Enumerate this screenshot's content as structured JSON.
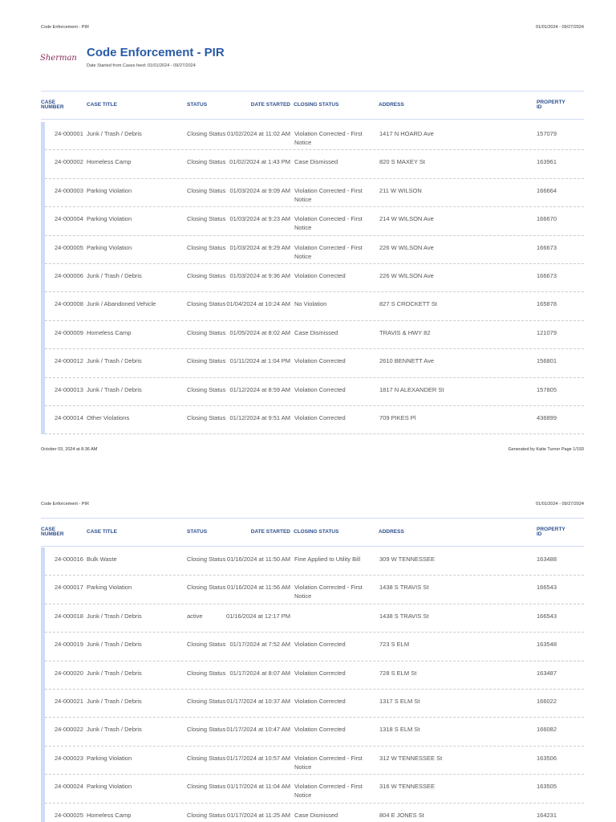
{
  "header": {
    "left": "Code Enforcement - PIR",
    "right": "01/01/2024 - 09/27/2024"
  },
  "report": {
    "logo_text": "Sherman",
    "title": "Code Enforcement - PIR",
    "subtitle": "Date Started from Cases feed: 01/01/2024 - 09/27/2024"
  },
  "columns": [
    "CASE NUMBER",
    "CASE TITLE",
    "STATUS",
    "DATE STARTED",
    "CLOSING STATUS",
    "ADDRESS",
    "PROPERTY ID"
  ],
  "footer": {
    "left": "October 03, 2024 at 8:36 AM",
    "right": "Generated by Katie Turner  Page 1/193"
  },
  "page1_rows": [
    [
      "24-000001",
      "Junk / Trash / Debris",
      "Closing Status",
      "01/02/2024 at 11:02 AM",
      "Violation Corrected - First Notice",
      "1417 N HOARD Ave",
      "157079"
    ],
    [
      "24-000002",
      "Homeless Camp",
      "Closing Status",
      "01/02/2024 at 1:43 PM",
      "Case Dismissed",
      "820 S MAXEY St",
      "163961"
    ],
    [
      "24-000003",
      "Parking Violation",
      "Closing Status",
      "01/03/2024 at 9:09 AM",
      "Violation Corrected - First Notice",
      "211 W WILSON",
      "166664"
    ],
    [
      "24-000004",
      "Parking Violation",
      "Closing Status",
      "01/03/2024 at 9:23 AM",
      "Violation Corrected - First Notice",
      "214 W WILSON Ave",
      "166670"
    ],
    [
      "24-000005",
      "Parking Violation",
      "Closing Status",
      "01/03/2024 at 9:29 AM",
      "Violation Corrected - First Notice",
      "226 W WILSON Ave",
      "166673"
    ],
    [
      "24-000006",
      "Junk / Trash / Debris",
      "Closing Status",
      "01/03/2024 at 9:36 AM",
      "Violation Corrected",
      "226 W WILSON Ave",
      "166673"
    ],
    [
      "24-000008",
      "Junk / Abandoned Vehicle",
      "Closing Status",
      "01/04/2024 at 10:24 AM",
      "No Violation",
      "827 S CROCKETT St",
      "165878"
    ],
    [
      "24-000009",
      "Homeless Camp",
      "Closing Status",
      "01/05/2024 at 8:02 AM",
      "Case Dismissed",
      "TRAVIS & HWY 82",
      "121079"
    ],
    [
      "24-000012",
      "Junk / Trash / Debris",
      "Closing Status",
      "01/11/2024 at 1:04 PM",
      "Violation Corrected",
      "2610 BENNETT Ave",
      "156801"
    ],
    [
      "24-000013",
      "Junk / Trash / Debris",
      "Closing Status",
      "01/12/2024 at 8:59 AM",
      "Violation Corrected",
      "1817 N ALEXANDER St",
      "157805"
    ],
    [
      "24-000014",
      "Other Violations",
      "Closing Status",
      "01/12/2024 at 9:51 AM",
      "Violation Corrected",
      "709 PIKES Pl",
      "436899"
    ]
  ],
  "page2_rows": [
    [
      "24-000016",
      "Bulk Waste",
      "Closing Status",
      "01/16/2024 at 11:50 AM",
      "Fine Applied to Utility Bill",
      "309 W TENNESSEE",
      "163488"
    ],
    [
      "24-000017",
      "Parking Violation",
      "Closing Status",
      "01/16/2024 at 11:56 AM",
      "Violation Corrected - First Notice",
      "1438 S TRAVIS St",
      "166543"
    ],
    [
      "24-000018",
      "Junk / Trash / Debris",
      "active",
      "01/16/2024 at 12:17 PM",
      "",
      "1438 S TRAVIS St",
      "166543"
    ],
    [
      "24-000019",
      "Junk / Trash / Debris",
      "Closing Status",
      "01/17/2024 at 7:52 AM",
      "Violation Corrected",
      "723 S ELM",
      "163548"
    ],
    [
      "24-000020",
      "Junk / Trash / Debris",
      "Closing Status",
      "01/17/2024 at 8:07 AM",
      "Violation Corrected",
      "728 S ELM St",
      "163487"
    ],
    [
      "24-000021",
      "Junk / Trash / Debris",
      "Closing Status",
      "01/17/2024 at 10:37 AM",
      "Violation Corrected",
      "1317 S ELM St",
      "166022"
    ],
    [
      "24-000022",
      "Junk / Trash / Debris",
      "Closing Status",
      "01/17/2024 at 10:47 AM",
      "Violation Corrected",
      "1318 S ELM St",
      "166082"
    ],
    [
      "24-000023",
      "Parking Violation",
      "Closing Status",
      "01/17/2024 at 10:57 AM",
      "Violation Corrected - First Notice",
      "312 W TENNESSEE St",
      "163506"
    ],
    [
      "24-000024",
      "Parking Violation",
      "Closing Status",
      "01/17/2024 at 11:04 AM",
      "Violation Corrected - First Notice",
      "316 W TENNESSEE",
      "163505"
    ],
    [
      "24-000025",
      "Homeless Camp",
      "Closing Status",
      "01/17/2024 at 11:25 AM",
      "Case Dismissed",
      "804 E JONES St",
      "164231"
    ]
  ]
}
